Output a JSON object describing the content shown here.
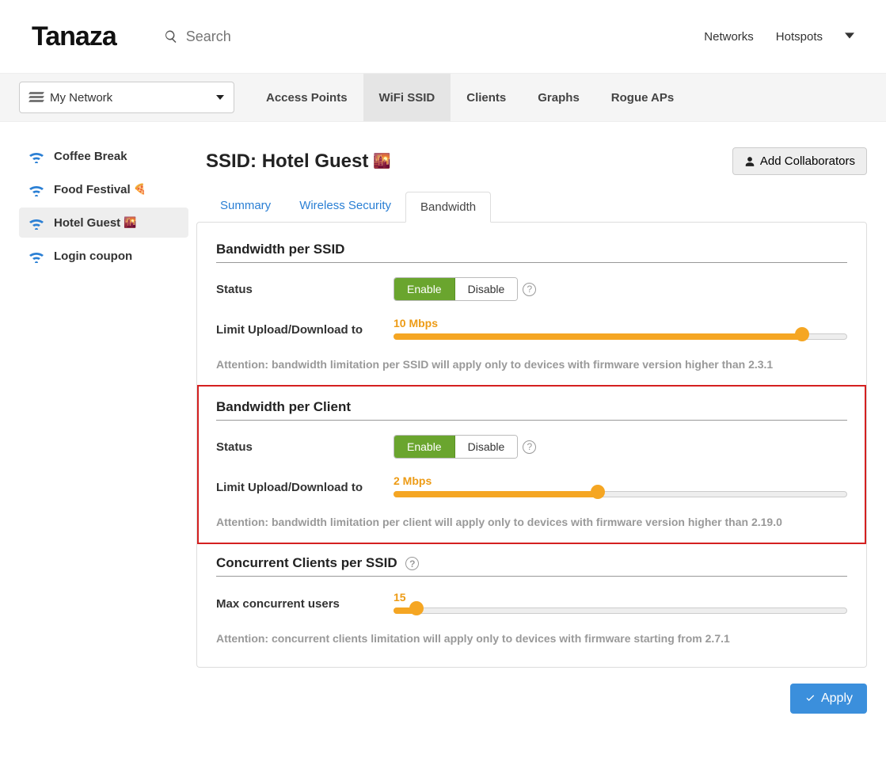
{
  "brand": "Tanaza",
  "search": {
    "placeholder": "Search"
  },
  "topnav": {
    "networks": "Networks",
    "hotspots": "Hotspots"
  },
  "network_select": {
    "label": "My Network"
  },
  "maintabs": {
    "access_points": "Access Points",
    "wifi_ssid": "WiFi SSID",
    "clients": "Clients",
    "graphs": "Graphs",
    "rogue_aps": "Rogue APs"
  },
  "sidebar": {
    "items": [
      {
        "label": "Coffee Break"
      },
      {
        "label": "Food Festival"
      },
      {
        "label": "Hotel Guest"
      },
      {
        "label": "Login coupon"
      }
    ]
  },
  "title": {
    "prefix": "SSID: ",
    "name": "Hotel Guest"
  },
  "collab_btn": "Add Collaborators",
  "subtabs": {
    "summary": "Summary",
    "security": "Wireless Security",
    "bandwidth": "Bandwidth"
  },
  "sections": {
    "ssid": {
      "title": "Bandwidth per SSID",
      "status_label": "Status",
      "enable": "Enable",
      "disable": "Disable",
      "limit_label": "Limit Upload/Download to",
      "value": "10 Mbps",
      "fill_pct": 90,
      "note": "Attention: bandwidth limitation per SSID will apply only to devices with firmware version higher than 2.3.1"
    },
    "client": {
      "title": "Bandwidth per Client",
      "status_label": "Status",
      "enable": "Enable",
      "disable": "Disable",
      "limit_label": "Limit Upload/Download to",
      "value": "2 Mbps",
      "fill_pct": 45,
      "note": "Attention: bandwidth limitation per client will apply only to devices with firmware version higher than 2.19.0"
    },
    "conc": {
      "title": "Concurrent Clients per SSID",
      "label": "Max concurrent users",
      "value": "15",
      "fill_pct": 5,
      "note": "Attention: concurrent clients limitation will apply only to devices with firmware starting from 2.7.1"
    }
  },
  "apply": "Apply"
}
